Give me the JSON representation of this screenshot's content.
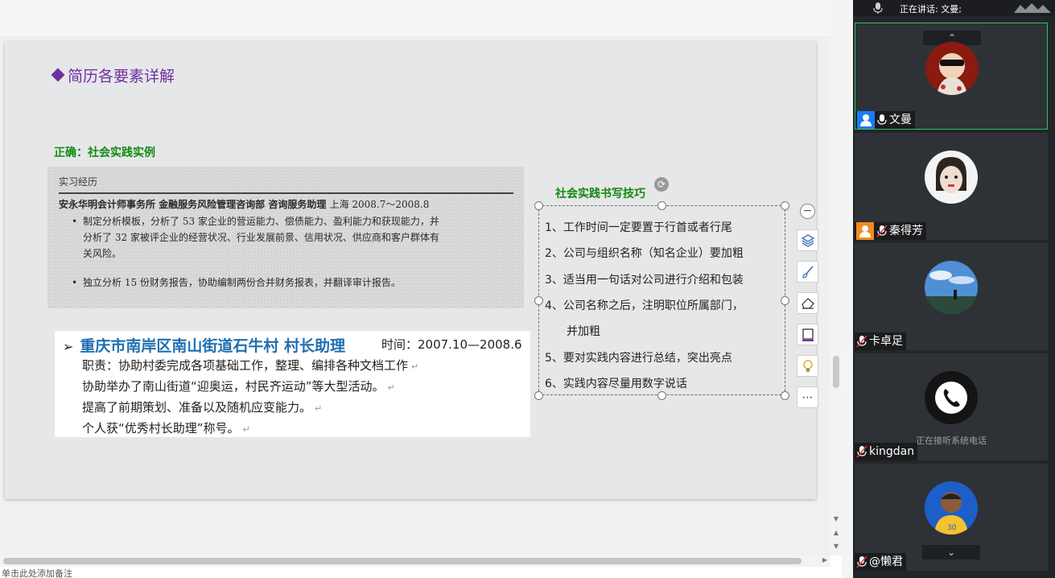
{
  "slide": {
    "title": "简历各要素详解",
    "correct_label": "正确：社会实践实例",
    "scan1": {
      "heading": "实习经历",
      "company": "安永华明会计师事务所 金融服务风险管理咨询部 咨询服务助理",
      "period": "上海 2008.7～2008.8",
      "bullets": [
        "制定分析模板，分析了 53 家企业的营运能力、偿债能力、盈利能力和获现能力，并",
        "分析了 32 家被评企业的经营状况、行业发展前景、信用状况、供应商和客户群体有",
        "关风险。",
        "独立分析 15 份财务报告，协助编制两份合并财务报表，并翻译审计报告。"
      ]
    },
    "scan2": {
      "arrow": "➢",
      "title": "重庆市南岸区南山街道石牛村 村长助理",
      "time": "时间：2007.10—2008.6",
      "lines": [
        "职责：协助村委完成各项基础工作，整理、编排各种文档工作",
        "协助举办了南山街道“迎奥运，村民齐运动”等大型活动。",
        "提高了前期策划、准备以及随机应变能力。",
        "个人获“优秀村长助理”称号。"
      ],
      "return_mark": "↵"
    },
    "tips": {
      "title": "社会实践书写技巧",
      "items": [
        "1、工作时间一定要置于行首或者行尾",
        "2、公司与组织名称（知名企业）要加粗",
        "3、适当用一句话对公司进行介绍和包装",
        "4、公司名称之后，注明职位所属部门，",
        "并加粗",
        "5、要对实践内容进行总结，突出亮点",
        "6、实践内容尽量用数字说话"
      ]
    }
  },
  "side_tools": [
    {
      "name": "collapse-icon",
      "glyph": "−"
    },
    {
      "name": "layers-icon"
    },
    {
      "name": "brush-icon"
    },
    {
      "name": "eraser-icon"
    },
    {
      "name": "frame-icon"
    },
    {
      "name": "lightbulb-icon"
    },
    {
      "name": "more-icon",
      "glyph": "⋯"
    }
  ],
  "notes_placeholder": "单击此处添加备注",
  "meeting": {
    "speaking_text": "正在讲话: 文曼;",
    "participants": [
      {
        "name": "文曼",
        "badge": "host",
        "badge_color": "#1a7cf5",
        "mic": "on",
        "active": true
      },
      {
        "name": "秦得芳",
        "badge": "cohost",
        "badge_color": "#f08c1e",
        "mic": "muted",
        "active": false
      },
      {
        "name": "卡卓足",
        "badge": "",
        "mic": "muted",
        "active": false
      },
      {
        "name": "kingdan",
        "badge": "",
        "mic": "muted",
        "active": false,
        "caption": "正在接听系统电话"
      },
      {
        "name": "@懒君",
        "badge": "",
        "mic": "muted",
        "active": false
      }
    ],
    "scroll_up": "⌃",
    "scroll_down": "⌄"
  },
  "colors": {
    "title_purple": "#7030a0",
    "green_label": "#118a11",
    "blue_heading": "#1f6fb2",
    "active_border": "#29c35d"
  }
}
